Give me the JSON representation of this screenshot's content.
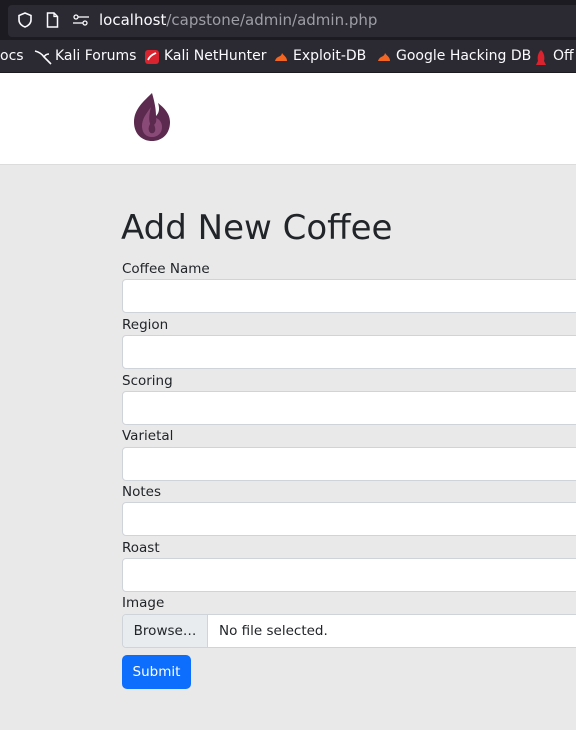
{
  "browser": {
    "url_host": "localhost",
    "url_path": "/capstone/admin/admin.php",
    "bookmarks": [
      {
        "label": "ocs",
        "icon": "docs-icon"
      },
      {
        "label": "Kali Forums",
        "icon": "kali-dragon-icon"
      },
      {
        "label": "Kali NetHunter",
        "icon": "nethunter-icon"
      },
      {
        "label": "Exploit-DB",
        "icon": "exploit-db-icon"
      },
      {
        "label": "Google Hacking DB",
        "icon": "ghdb-icon"
      },
      {
        "label": "Off",
        "icon": "offsec-icon"
      }
    ]
  },
  "page": {
    "title": "Add New Coffee",
    "fields": [
      {
        "label": "Coffee Name",
        "value": ""
      },
      {
        "label": "Region",
        "value": ""
      },
      {
        "label": "Scoring",
        "value": ""
      },
      {
        "label": "Varietal",
        "value": ""
      },
      {
        "label": "Notes",
        "value": ""
      },
      {
        "label": "Roast",
        "value": ""
      }
    ],
    "image": {
      "label": "Image",
      "browse_label": "Browse…",
      "status": "No file selected."
    },
    "submit_label": "Submit"
  },
  "colors": {
    "primary": "#0d6efd",
    "logo": "#5b2a4e",
    "page_bg": "#e9e9e9"
  }
}
